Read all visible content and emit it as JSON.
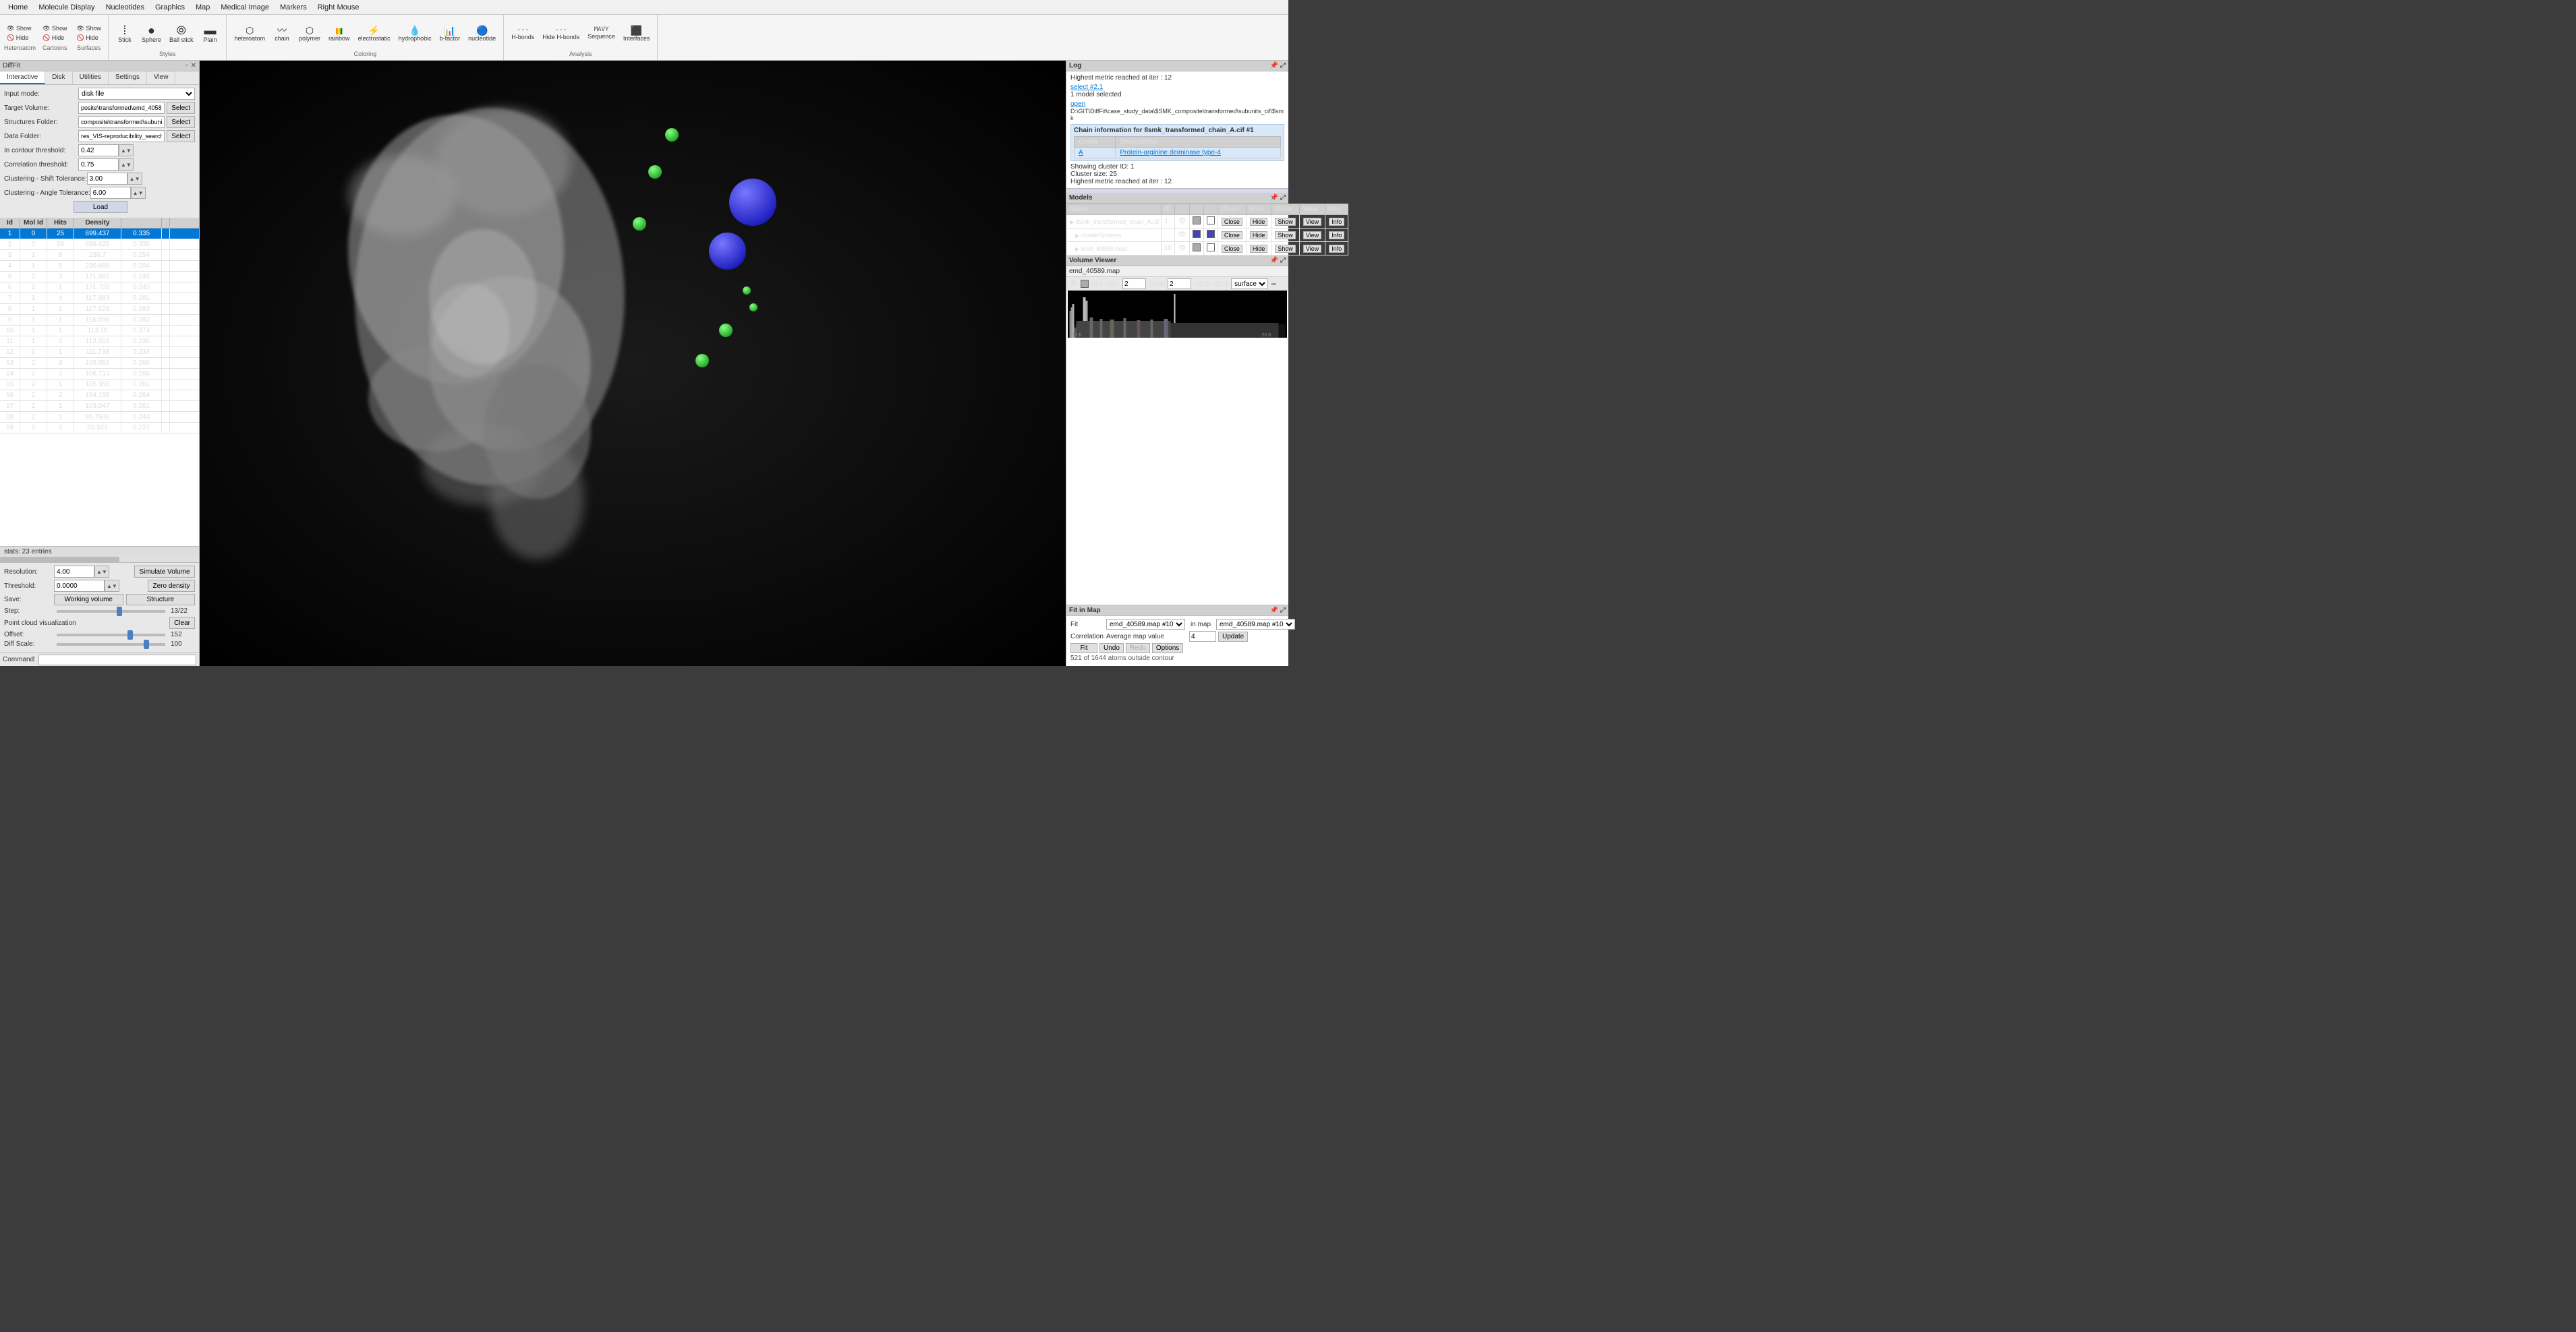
{
  "app": {
    "title": "DiffFit",
    "menubar": [
      "Home",
      "Molecule Display",
      "Nucleotides",
      "Graphics",
      "Map",
      "Medical Image",
      "Markers",
      "Right Mouse"
    ]
  },
  "ribbon": {
    "groups": [
      {
        "label": "",
        "buttons": [
          {
            "id": "show-btn",
            "icon": "👁",
            "label": "Show",
            "type": "showhide"
          },
          {
            "id": "hide-btn",
            "icon": "🚫",
            "label": "Hide",
            "type": "showhide"
          }
        ]
      },
      {
        "label": "Styles",
        "buttons": [
          {
            "id": "stick-btn",
            "icon": "⁞",
            "label": "Stick"
          },
          {
            "id": "sphere-btn",
            "icon": "●",
            "label": "Sphere"
          },
          {
            "id": "ball-btn",
            "icon": "⦾",
            "label": "Ball stick"
          },
          {
            "id": "plain-btn",
            "icon": "▬",
            "label": "Plain"
          }
        ]
      },
      {
        "label": "Coloring",
        "buttons": [
          {
            "id": "heteroatom-btn",
            "icon": "⬡",
            "label": "heteroatom"
          },
          {
            "id": "chain-btn",
            "icon": "〰",
            "label": "chain"
          },
          {
            "id": "polymer-btn",
            "icon": "⬡",
            "label": "polymer"
          },
          {
            "id": "rainbow-btn",
            "icon": "🌈",
            "label": "rainbow"
          },
          {
            "id": "electrostatic-btn",
            "icon": "⚡",
            "label": "electrostatic"
          },
          {
            "id": "hydrophobic-btn",
            "icon": "💧",
            "label": "hydrophobic"
          },
          {
            "id": "bfactor-btn",
            "icon": "📊",
            "label": "b-factor"
          },
          {
            "id": "nucleotide-btn",
            "icon": "🔵",
            "label": "nucleotide"
          }
        ]
      },
      {
        "label": "Analysis",
        "buttons": [
          {
            "id": "hbonds-btn",
            "icon": "---",
            "label": "H-bonds"
          },
          {
            "id": "hidehbonds-btn",
            "icon": "---",
            "label": "Hide H-bonds"
          },
          {
            "id": "sequence-btn",
            "icon": "MAVYVG",
            "label": "Sequence"
          },
          {
            "id": "interfaces-btn",
            "icon": "⬛",
            "label": "Interfaces"
          }
        ]
      }
    ]
  },
  "difffit": {
    "panel_title": "DiffFit",
    "tabs": [
      "Interactive",
      "Disk",
      "Utilities",
      "Settings",
      "View"
    ],
    "active_tab": "Interactive",
    "fields": {
      "input_mode_label": "Input mode:",
      "input_mode_value": "disk file",
      "target_volume_label": "Target Volume:",
      "target_volume_value": "posite\\transformed\\emd_40589.map",
      "target_volume_btn": "Select",
      "structures_folder_label": "Structures Folder:",
      "structures_folder_value": "composite\\transformed\\subunits_cif",
      "structures_folder_btn": "Select",
      "data_folder_label": "Data Folder:",
      "data_folder_value": "res_VIS-reproducibility_search_1K_r0",
      "data_folder_btn": "Select",
      "in_contour_label": "In contour threshold:",
      "in_contour_value": "0.42",
      "correlation_label": "Correlation threshold:",
      "correlation_value": "0.75",
      "clustering_shift_label": "Clustering - Shift Tolerance:",
      "clustering_shift_value": "3.00",
      "clustering_angle_label": "Clustering - Angle Tolerance:",
      "clustering_angle_value": "6.00",
      "load_btn": "Load"
    },
    "table": {
      "headers": [
        "Id",
        "Mol Id",
        "Hits",
        "Density",
        ""
      ],
      "rows": [
        {
          "id": "1",
          "mol_id": "0",
          "hits": "25",
          "density": "699.437",
          "val": "0.335",
          "selected": true
        },
        {
          "id": "2",
          "mol_id": "0",
          "hits": "26",
          "density": "699.425",
          "val": "0.335",
          "selected": false
        },
        {
          "id": "3",
          "mol_id": "1",
          "hits": "8",
          "density": "230.7",
          "val": "0.294",
          "selected": false
        },
        {
          "id": "4",
          "mol_id": "1",
          "hits": "5",
          "density": "230.686",
          "val": "0.294",
          "selected": false
        },
        {
          "id": "5",
          "mol_id": "2",
          "hits": "3",
          "density": "171.862",
          "val": "0.246",
          "selected": false
        },
        {
          "id": "6",
          "mol_id": "2",
          "hits": "1",
          "density": "171.703",
          "val": "0.245",
          "selected": false
        },
        {
          "id": "7",
          "mol_id": "1",
          "hits": "4",
          "density": "117.983",
          "val": "0.281",
          "selected": false
        },
        {
          "id": "8",
          "mol_id": "1",
          "hits": "1",
          "density": "117.623",
          "val": "0.283",
          "selected": false
        },
        {
          "id": "9",
          "mol_id": "1",
          "hits": "1",
          "density": "116.858",
          "val": "0.282",
          "selected": false
        },
        {
          "id": "10",
          "mol_id": "1",
          "hits": "1",
          "density": "113.78",
          "val": "0.274",
          "selected": false
        },
        {
          "id": "11",
          "mol_id": "1",
          "hits": "2",
          "density": "113.355",
          "val": "0.235",
          "selected": false
        },
        {
          "id": "12",
          "mol_id": "1",
          "hits": "1",
          "density": "111.738",
          "val": "0.234",
          "selected": false
        },
        {
          "id": "13",
          "mol_id": "2",
          "hits": "3",
          "density": "108.051",
          "val": "0.266",
          "selected": false
        },
        {
          "id": "14",
          "mol_id": "2",
          "hits": "2",
          "density": "106.713",
          "val": "0.266",
          "selected": false
        },
        {
          "id": "15",
          "mol_id": "2",
          "hits": "1",
          "density": "105.355",
          "val": "0.261",
          "selected": false
        },
        {
          "id": "16",
          "mol_id": "2",
          "hits": "2",
          "density": "104.155",
          "val": "0.264",
          "selected": false
        },
        {
          "id": "17",
          "mol_id": "2",
          "hits": "1",
          "density": "103.047",
          "val": "0.261",
          "selected": false
        },
        {
          "id": "18",
          "mol_id": "2",
          "hits": "1",
          "density": "96.7633",
          "val": "0.243",
          "selected": false
        },
        {
          "id": "19",
          "mol_id": "2",
          "hits": "3",
          "density": "93.521",
          "val": "0.227",
          "selected": false
        }
      ]
    },
    "stats": "stats: 23 entries",
    "bottom": {
      "resolution_label": "Resolution:",
      "resolution_value": "4.00",
      "simulate_btn": "Simulate Volume",
      "threshold_label": "Threshold:",
      "threshold_value": "0.0000",
      "zero_density_btn": "Zero density",
      "save_label": "Save:",
      "working_volume_btn": "Working volume",
      "structure_btn": "Structure",
      "step_label": "Step:",
      "step_value": "13/22",
      "point_cloud_label": "Point cloud visualization",
      "clear_btn": "Clear",
      "offset_label": "Offset:",
      "offset_value": "152",
      "diff_scale_label": "Diff Scale:",
      "diff_scale_value": "100"
    }
  },
  "log": {
    "section_title": "Log",
    "text1": "Highest metric reached at iter : 12",
    "link1": "select #2.1",
    "text2": "1 model selected",
    "link2": "open",
    "path": "D:\\GIT\\DiffFit\\case_study_data\\$SMK_composite\\transformed\\subunits_cif\\$smk",
    "chain_info_title": "Chain information for 8smk_transformed_chain_A.cif #1",
    "chain_table": {
      "headers": [
        "Chain",
        "Description"
      ],
      "rows": [
        {
          "chain": "A",
          "description": "Protein-arginine deiminase type-4"
        }
      ]
    },
    "text3": "Showing cluster ID: 1",
    "text4": "Cluster size: 25",
    "text5": "Highest metric reached at iter : 12"
  },
  "models": {
    "section_title": "Models",
    "columns": [
      "Name",
      "ID",
      "",
      "",
      "",
      "Close",
      "Hide",
      "Show",
      "View",
      "Info"
    ],
    "rows": [
      {
        "name": "8smk_transformed_chain_A.cif",
        "id": "1",
        "expanded": true
      },
      {
        "name": "clusterSpheres",
        "id": "",
        "expanded": false
      },
      {
        "name": "emd_40589.map",
        "id": "10",
        "expanded": false
      }
    ]
  },
  "volume_viewer": {
    "section_title": "Volume Viewer",
    "map_name": "emd_40589.map",
    "eye_icon": "👁",
    "id_value": "#10",
    "step_label": "step:",
    "step_value": "2",
    "level_label": "Level",
    "level_value": "2",
    "range": "-12.6 - 20.8",
    "surface_label": "surface"
  },
  "fit_in_map": {
    "section_title": "Fit in Map",
    "fit_label": "Fit",
    "fit_map1": "emd_40589.map #10",
    "in_label": "in map",
    "fit_map2": "emd_40589.map #10",
    "correlation_label": "Correlation",
    "avg_map_label": "Average map value",
    "avg_map_value": "4",
    "update_btn": "Update",
    "fit_btn": "Fit",
    "undo_btn": "Undo",
    "redo_btn": "Redo",
    "options_btn": "Options",
    "status": "521 of 1644 atoms outside contour"
  },
  "command": {
    "label": "Command:"
  }
}
